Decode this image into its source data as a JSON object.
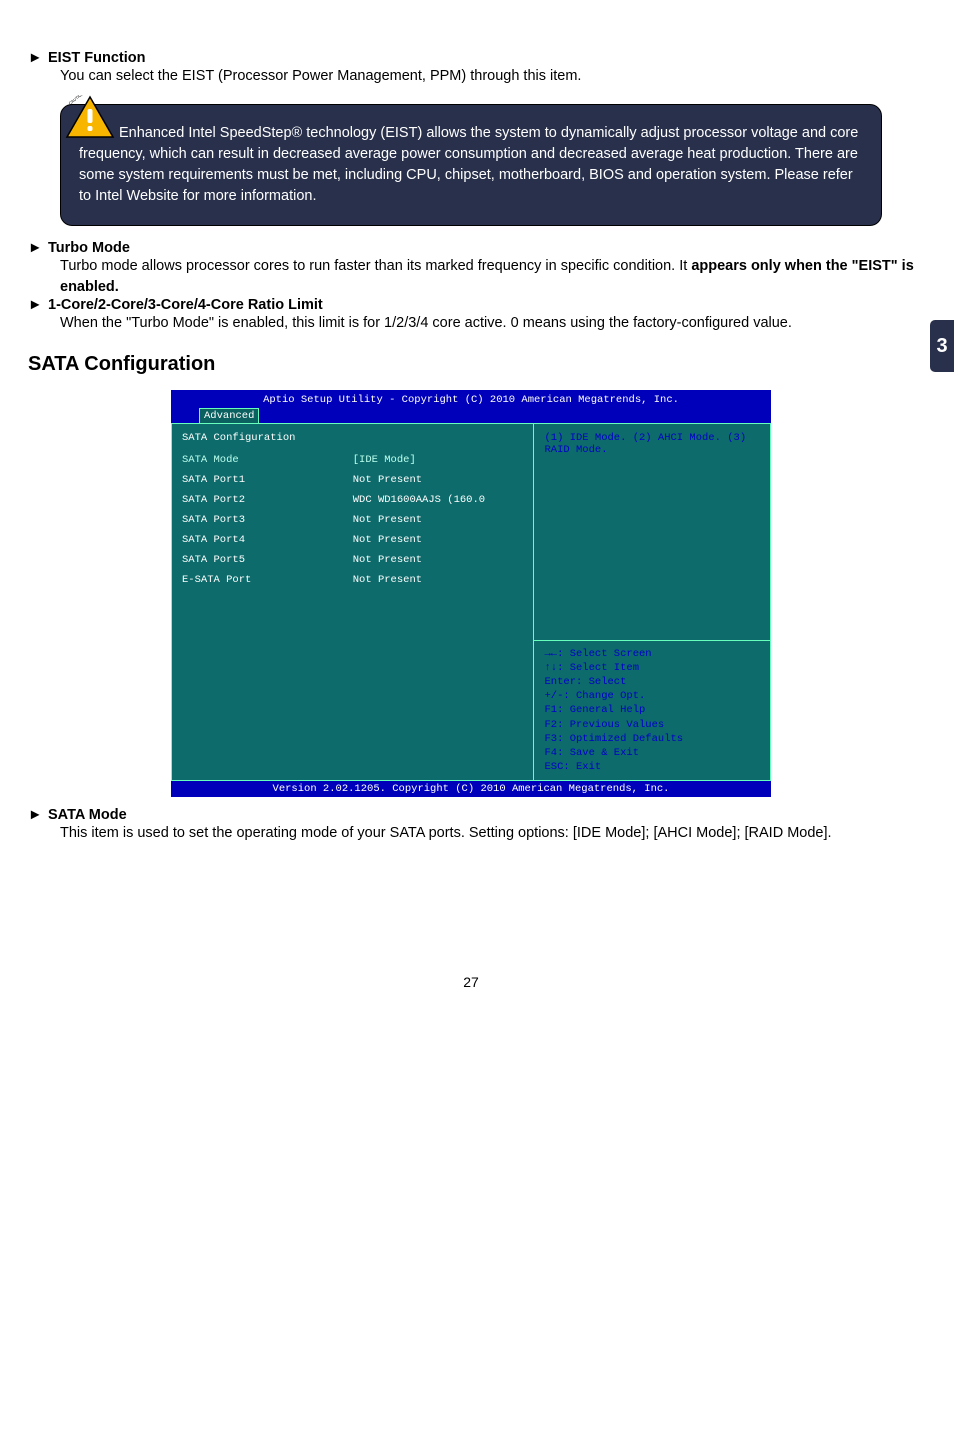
{
  "side_tab": "3",
  "eist": {
    "marker": "►",
    "title": "EIST Function",
    "body": "You can select the EIST (Processor Power Management, PPM) through this item."
  },
  "caution": {
    "text": "Enhanced Intel SpeedStep® technology (EIST) allows the system to dynamically adjust processor voltage and core frequency, which can result in decreased average power consumption and decreased average heat production. There are some system requirements must be met, including CPU, chipset, motherboard, BIOS and operation system. Please refer to Intel Website for more information."
  },
  "turbo": {
    "marker": "►",
    "title": "Turbo Mode",
    "body_a": "Turbo mode allows processor cores to run faster than its marked frequency in specific condition. It ",
    "body_b": "appears only when the \"EIST\" is enabled."
  },
  "core_ratio": {
    "marker": "►",
    "title": "1-Core/2-Core/3-Core/4-Core Ratio Limit",
    "body": "When the \"Turbo Mode\" is enabled, this limit is for 1/2/3/4 core active. 0 means using the factory-configured value."
  },
  "sata_section_title": "SATA Configuration",
  "bios": {
    "top_title": "Aptio Setup Utility - Copyright (C) 2010 American Megatrends, Inc.",
    "tab": "Advanced",
    "left_heading": "SATA Configuration",
    "rows": [
      {
        "key": "SATA Mode",
        "val": "[IDE Mode]"
      },
      {
        "key": "SATA Port1",
        "val": "Not Present"
      },
      {
        "key": "SATA Port2",
        "val": "WDC WD1600AAJS (160.0"
      },
      {
        "key": "SATA Port3",
        "val": "Not Present"
      },
      {
        "key": "SATA Port4",
        "val": "Not Present"
      },
      {
        "key": "SATA Port5",
        "val": "Not Present"
      },
      {
        "key": "E-SATA Port",
        "val": "Not Present"
      }
    ],
    "right_help": "(1) IDE Mode. (2) AHCI Mode. (3) RAID Mode.",
    "right_keys": [
      "→←: Select Screen",
      "↑↓: Select Item",
      "Enter: Select",
      "+/-: Change Opt.",
      "F1: General Help",
      "F2: Previous Values",
      "F3: Optimized Defaults",
      "F4: Save & Exit",
      "ESC: Exit"
    ],
    "bottom": "Version 2.02.1205. Copyright (C) 2010 American Megatrends, Inc."
  },
  "sata_mode": {
    "marker": "►",
    "title": "SATA Mode",
    "body": "This item is used to set the operating mode of your SATA ports. Setting options: [IDE Mode]; [AHCI Mode]; [RAID Mode]."
  },
  "page_number": "27",
  "chart_data": {
    "type": "table",
    "title": "SATA Configuration — Aptio Setup Utility",
    "columns": [
      "Item",
      "Value"
    ],
    "rows": [
      [
        "SATA Mode",
        "[IDE Mode]"
      ],
      [
        "SATA Port1",
        "Not Present"
      ],
      [
        "SATA Port2",
        "WDC WD1600AAJS (160.0"
      ],
      [
        "SATA Port3",
        "Not Present"
      ],
      [
        "SATA Port4",
        "Not Present"
      ],
      [
        "SATA Port5",
        "Not Present"
      ],
      [
        "E-SATA Port",
        "Not Present"
      ]
    ],
    "help_text": "(1) IDE Mode. (2) AHCI Mode. (3) RAID Mode.",
    "footer": "Version 2.02.1205. Copyright (C) 2010 American Megatrends, Inc."
  }
}
